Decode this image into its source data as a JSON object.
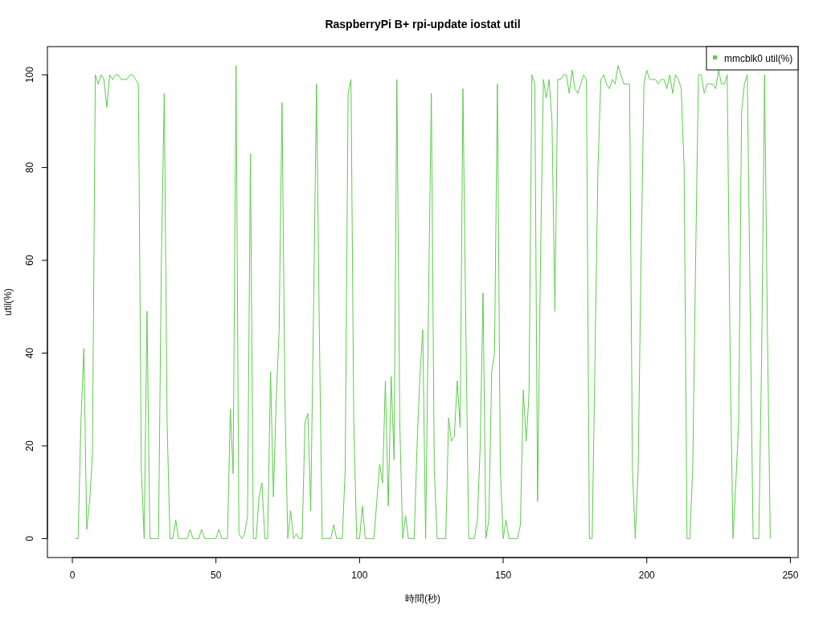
{
  "chart_data": {
    "type": "line",
    "title": "RaspberryPi B+ rpi-update iostat util",
    "xlabel": "時間(秒)",
    "ylabel": "util(%)",
    "x": [
      1,
      2,
      3,
      4,
      5,
      6,
      7,
      8,
      9,
      10,
      11,
      12,
      13,
      14,
      15,
      16,
      17,
      18,
      19,
      20,
      21,
      22,
      23,
      24,
      25,
      26,
      27,
      28,
      29,
      30,
      31,
      32,
      33,
      34,
      35,
      36,
      37,
      38,
      39,
      40,
      41,
      42,
      43,
      44,
      45,
      46,
      47,
      48,
      49,
      50,
      51,
      52,
      53,
      54,
      55,
      56,
      57,
      58,
      59,
      60,
      61,
      62,
      63,
      64,
      65,
      66,
      67,
      68,
      69,
      70,
      71,
      72,
      73,
      74,
      75,
      76,
      77,
      78,
      79,
      80,
      81,
      82,
      83,
      84,
      85,
      86,
      87,
      88,
      89,
      90,
      91,
      92,
      93,
      94,
      95,
      96,
      97,
      98,
      99,
      100,
      101,
      102,
      103,
      104,
      105,
      106,
      107,
      108,
      109,
      110,
      111,
      112,
      113,
      114,
      115,
      116,
      117,
      118,
      119,
      120,
      121,
      122,
      123,
      124,
      125,
      126,
      127,
      128,
      129,
      130,
      131,
      132,
      133,
      134,
      135,
      136,
      137,
      138,
      139,
      140,
      141,
      142,
      143,
      144,
      145,
      146,
      147,
      148,
      149,
      150,
      151,
      152,
      153,
      154,
      155,
      156,
      157,
      158,
      159,
      160,
      161,
      162,
      163,
      164,
      165,
      166,
      167,
      168,
      169,
      170,
      171,
      172,
      173,
      174,
      175,
      176,
      177,
      178,
      179,
      180,
      181,
      182,
      183,
      184,
      185,
      186,
      187,
      188,
      189,
      190,
      191,
      192,
      193,
      194,
      195,
      196,
      197,
      198,
      199,
      200,
      201,
      202,
      203,
      204,
      205,
      206,
      207,
      208,
      209,
      210,
      211,
      212,
      213,
      214,
      215,
      216,
      217,
      218,
      219,
      220,
      221,
      222,
      223,
      224,
      225,
      226,
      227,
      228,
      229,
      230,
      231,
      232,
      233,
      234,
      235,
      236,
      237,
      238,
      239,
      240,
      241,
      242,
      243
    ],
    "series": [
      {
        "name": "mmcblk0 util(%)",
        "color": "#5ccd4a",
        "values": [
          0,
          0,
          25,
          41,
          2,
          8,
          18,
          100,
          98,
          100,
          99,
          93,
          100,
          99,
          100,
          100,
          99,
          99,
          99,
          100,
          100,
          99,
          98,
          15,
          0,
          49,
          0,
          0,
          0,
          0,
          60,
          96,
          25,
          0,
          0,
          4,
          0,
          0,
          0,
          0,
          2,
          0,
          0,
          0,
          2,
          0,
          0,
          0,
          0,
          0,
          2,
          0,
          0,
          0,
          28,
          14,
          102,
          1,
          0,
          1,
          5,
          83,
          0,
          0,
          9,
          12,
          0,
          0,
          36,
          9,
          30,
          45,
          94,
          30,
          0,
          6,
          0,
          1,
          0,
          0,
          25,
          27,
          6,
          50,
          98,
          45,
          0,
          0,
          0,
          0,
          3,
          0,
          0,
          0,
          15,
          96,
          99,
          25,
          0,
          0,
          7,
          0,
          0,
          0,
          0,
          8,
          16,
          12,
          34,
          7,
          35,
          17,
          99,
          25,
          0,
          5,
          0,
          0,
          0,
          20,
          35,
          45,
          0,
          50,
          96,
          15,
          0,
          0,
          0,
          0,
          26,
          21,
          22,
          34,
          24,
          97,
          45,
          0,
          0,
          0,
          4,
          20,
          53,
          0,
          4,
          36,
          40,
          98,
          15,
          0,
          4,
          0,
          0,
          0,
          0,
          3,
          32,
          21,
          31,
          100,
          98,
          8,
          60,
          99,
          95,
          99,
          90,
          49,
          99,
          99,
          100,
          100,
          96,
          101,
          97,
          96,
          98,
          100,
          99,
          0,
          0,
          40,
          80,
          99,
          100,
          98,
          97,
          99,
          98,
          102,
          100,
          98,
          98,
          98,
          15,
          0,
          15,
          60,
          98,
          101,
          99,
          99,
          99,
          98,
          99,
          99,
          97,
          100,
          96,
          100,
          99,
          97,
          80,
          0,
          0,
          15,
          60,
          100,
          100,
          96,
          98,
          98,
          98,
          97,
          101,
          98,
          98,
          100,
          40,
          0,
          12,
          25,
          92,
          98,
          100,
          50,
          0,
          0,
          0,
          40,
          100,
          45,
          0
        ]
      }
    ],
    "xlim": [
      -8.68,
      252.68
    ],
    "ylim": [
      -4.08,
      106.08
    ],
    "xticks": [
      0,
      50,
      100,
      150,
      200,
      250
    ],
    "yticks": [
      0,
      20,
      40,
      60,
      80,
      100
    ]
  }
}
